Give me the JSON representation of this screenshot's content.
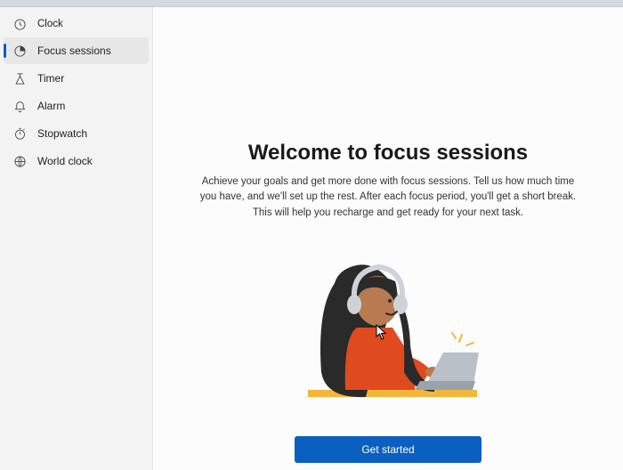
{
  "app_title": "Clock",
  "sidebar": {
    "items": [
      {
        "label": "Clock",
        "icon": "clock-icon"
      },
      {
        "label": "Focus sessions",
        "icon": "focus-icon",
        "selected": true
      },
      {
        "label": "Timer",
        "icon": "timer-icon"
      },
      {
        "label": "Alarm",
        "icon": "alarm-icon"
      },
      {
        "label": "Stopwatch",
        "icon": "stopwatch-icon"
      },
      {
        "label": "World clock",
        "icon": "world-clock-icon"
      }
    ]
  },
  "main": {
    "heading": "Welcome to focus sessions",
    "description": "Achieve your goals and get more done with focus sessions. Tell us how much time you have, and we'll set up the rest. After each focus period, you'll get a short break. This will help you recharge and get ready for your next task.",
    "cta_label": "Get started",
    "illustration": "person-laptop-illustration"
  },
  "colors": {
    "accent": "#0a5fc0",
    "sidebar_bg": "#f3f3f3",
    "selected_bg": "#e7e7e7"
  }
}
